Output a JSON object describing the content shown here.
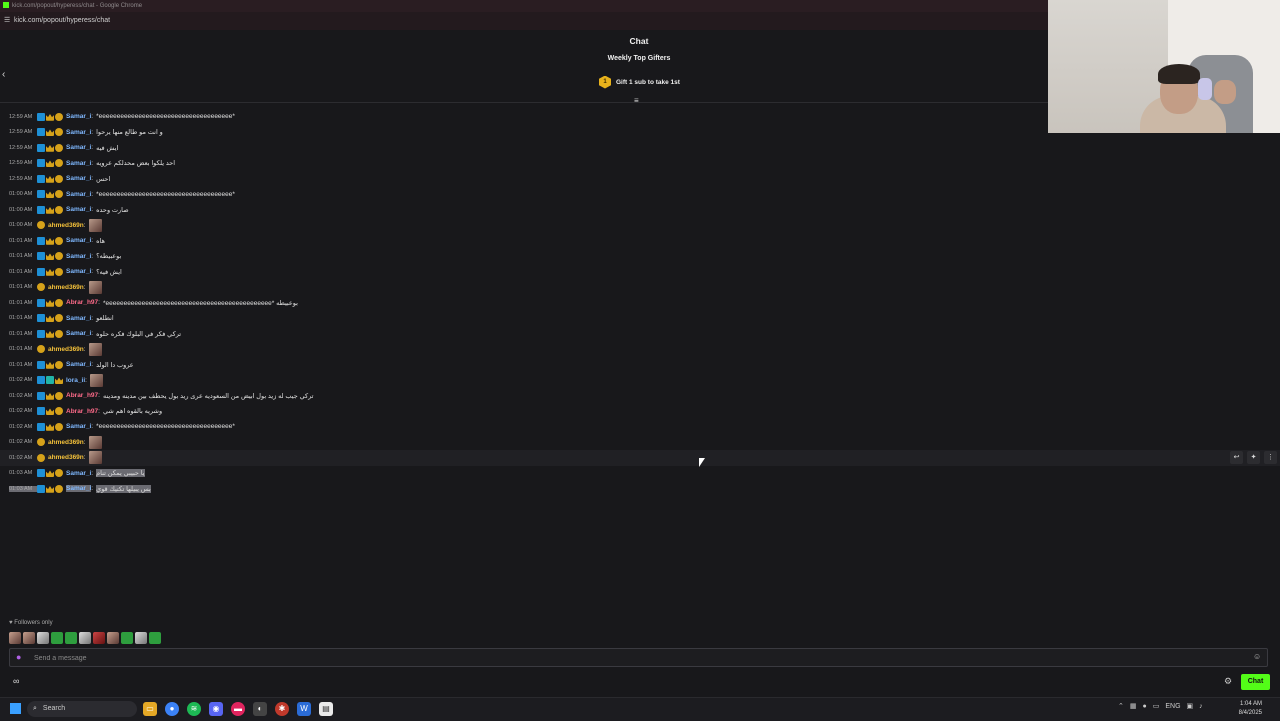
{
  "browser": {
    "window_title": "kick.com/popout/hyperess/chat - Google Chrome",
    "url": "kick.com/popout/hyperess/chat"
  },
  "header": {
    "title": "Chat",
    "weekly_top_gifters": "Weekly Top Gifters",
    "gift_rank": "1",
    "gift_cta": "Gift 1 sub to take 1st"
  },
  "messages": [
    {
      "time": "12:59 AM",
      "user": "Samar_i",
      "color": "#7fb8ff",
      "badges": [
        "blue",
        "crown",
        "sub"
      ],
      "text": "*eeeeeeeeeeeeeeeeeeeeeeeeeeeeeeeeeeeee*"
    },
    {
      "time": "12:59 AM",
      "user": "Samar_i",
      "color": "#7fb8ff",
      "badges": [
        "blue",
        "crown",
        "sub"
      ],
      "text": "و انت مو طالع منها يرحوا"
    },
    {
      "time": "12:59 AM",
      "user": "Samar_i",
      "color": "#7fb8ff",
      "badges": [
        "blue",
        "crown",
        "sub"
      ],
      "text": "ايش فيه"
    },
    {
      "time": "12:59 AM",
      "user": "Samar_i",
      "color": "#7fb8ff",
      "badges": [
        "blue",
        "crown",
        "sub"
      ],
      "text": "احد يلكوا بعض محدلكم عرويه"
    },
    {
      "time": "12:59 AM",
      "user": "Samar_i",
      "color": "#7fb8ff",
      "badges": [
        "blue",
        "crown",
        "sub"
      ],
      "text": "احس"
    },
    {
      "time": "01:00 AM",
      "user": "Samar_i",
      "color": "#7fb8ff",
      "badges": [
        "blue",
        "crown",
        "sub"
      ],
      "text": "*eeeeeeeeeeeeeeeeeeeeeeeeeeeeeeeeeeeee*"
    },
    {
      "time": "01:00 AM",
      "user": "Samar_i",
      "color": "#7fb8ff",
      "badges": [
        "blue",
        "crown",
        "sub"
      ],
      "text": "صارت وحده"
    },
    {
      "time": "01:00 AM",
      "user": "ahmed369n",
      "color": "#f5c23a",
      "badges": [
        "sub"
      ],
      "text": "",
      "emote": true
    },
    {
      "time": "01:01 AM",
      "user": "Samar_i",
      "color": "#7fb8ff",
      "badges": [
        "blue",
        "crown",
        "sub"
      ],
      "text": "هاه"
    },
    {
      "time": "01:01 AM",
      "user": "Samar_i",
      "color": "#7fb8ff",
      "badges": [
        "blue",
        "crown",
        "sub"
      ],
      "text": "بوعبيطه؟"
    },
    {
      "time": "01:01 AM",
      "user": "Samar_i",
      "color": "#7fb8ff",
      "badges": [
        "blue",
        "crown",
        "sub"
      ],
      "text": "ايش فيه؟"
    },
    {
      "time": "01:01 AM",
      "user": "ahmed369n",
      "color": "#f5c23a",
      "badges": [
        "sub"
      ],
      "text": "",
      "emote": true
    },
    {
      "time": "01:01 AM",
      "user": "Abrar_h97",
      "color": "#ff6b8a",
      "badges": [
        "blue",
        "crown",
        "sub"
      ],
      "text": "*eeeeeeeeeeeeeeeeeeeeeeeeeeeeeeeeeeeeeeeeeeeeee* بوعبيطه"
    },
    {
      "time": "01:01 AM",
      "user": "Samar_i",
      "color": "#7fb8ff",
      "badges": [
        "blue",
        "crown",
        "sub"
      ],
      "text": "انطلعو"
    },
    {
      "time": "01:01 AM",
      "user": "Samar_i",
      "color": "#7fb8ff",
      "badges": [
        "blue",
        "crown",
        "sub"
      ],
      "text": "تركي فكر في البلوك فكره حلوه"
    },
    {
      "time": "01:01 AM",
      "user": "ahmed369n",
      "color": "#f5c23a",
      "badges": [
        "sub"
      ],
      "text": "",
      "emote": true
    },
    {
      "time": "01:01 AM",
      "user": "Samar_i",
      "color": "#7fb8ff",
      "badges": [
        "blue",
        "crown",
        "sub"
      ],
      "text": "عروب دا الولد"
    },
    {
      "time": "01:02 AM",
      "user": "lora_ii",
      "color": "#7fb8ff",
      "badges": [
        "blue",
        "teal",
        "crown"
      ],
      "text": "",
      "emote": true
    },
    {
      "time": "01:02 AM",
      "user": "Abrar_h97",
      "color": "#ff6b8a",
      "badges": [
        "blue",
        "crown",
        "sub"
      ],
      "text": "تركي جيب له زيد بول ابيض من السعوديه عرى ريد بول يحطف بين مدينه ومدينه"
    },
    {
      "time": "01:02 AM",
      "user": "Abrar_h97",
      "color": "#ff6b8a",
      "badges": [
        "blue",
        "crown",
        "sub"
      ],
      "text": "وشريه بالقوه اهم شي"
    },
    {
      "time": "01:02 AM",
      "user": "Samar_i",
      "color": "#7fb8ff",
      "badges": [
        "blue",
        "crown",
        "sub"
      ],
      "text": "*eeeeeeeeeeeeeeeeeeeeeeeeeeeeeeeeeeeee*"
    },
    {
      "time": "01:02 AM",
      "user": "ahmed369n",
      "color": "#f5c23a",
      "badges": [
        "sub"
      ],
      "text": "",
      "emote": true
    },
    {
      "time": "01:02 AM",
      "user": "ahmed369n",
      "color": "#f5c23a",
      "badges": [
        "sub"
      ],
      "text": "",
      "emote": true,
      "highlight": true
    },
    {
      "time": "01:03 AM",
      "user": "Samar_i",
      "color": "#7fb8ff",
      "badges": [
        "blue",
        "crown",
        "sub"
      ],
      "text": "يا حبيبي يمكن تنام",
      "selected": true
    },
    {
      "time": "01:03 AM",
      "user": "Samar_i",
      "color": "#7fb8ff",
      "badges": [
        "blue",
        "crown",
        "sub"
      ],
      "text": "بس يبيلها تكتيك قوي",
      "selected": true,
      "selected_all": true
    }
  ],
  "followers_only": "Followers only",
  "composer": {
    "placeholder": "Send a message",
    "chat_button": "Chat"
  },
  "taskbar": {
    "search_label": "Search",
    "lang": "ENG",
    "time": "1:04 AM",
    "date": "8/4/2025"
  }
}
